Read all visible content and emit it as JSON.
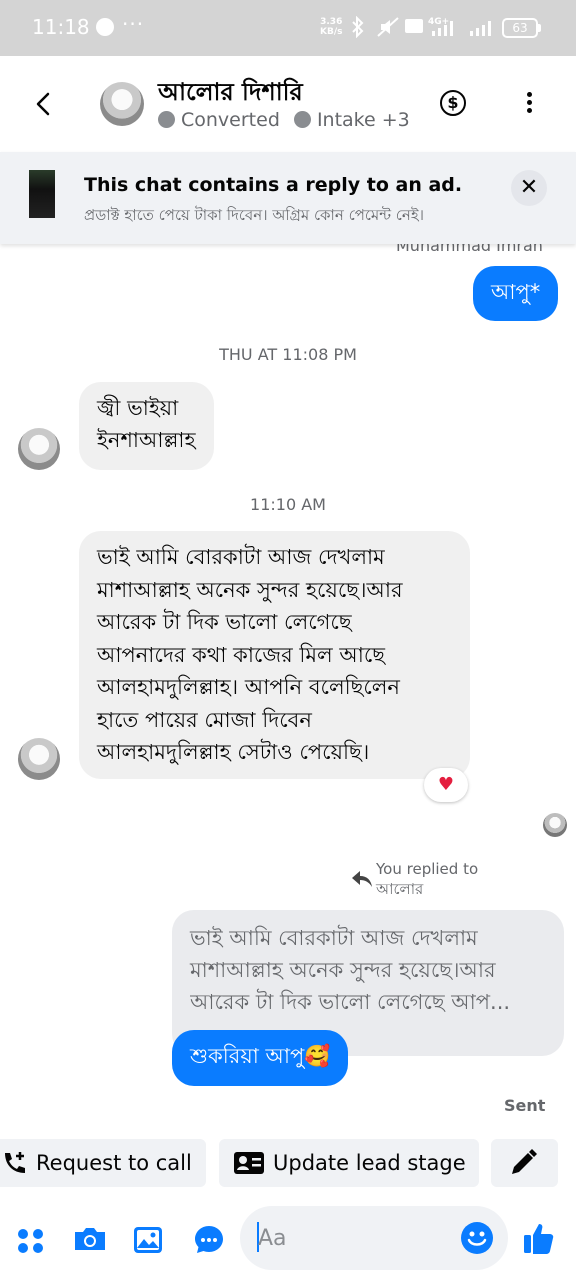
{
  "status_bar": {
    "time": "11:18",
    "dots": "···",
    "speed_value": "3.36",
    "speed_unit": "KB/s",
    "battery": "63"
  },
  "header": {
    "name": "আলোর দিশারি",
    "tag1": "Converted",
    "tag2": "Intake +3"
  },
  "ad_banner": {
    "title": "This chat contains a reply to an ad.",
    "subtitle": "প্রডাক্ট হাতে পেয়ে টাকা দিবেন। অগ্রিম কোন পেমেন্ট নেই।"
  },
  "messages": {
    "cut_name": "Muhammad Imran",
    "m1": "আপু*",
    "time1": "THU AT 11:08 PM",
    "m2_line1": "জ্বী ভাইয়া",
    "m2_line2": "ইনশাআল্লাহ",
    "time2": "11:10 AM",
    "m3_lines": [
      "ভাই আমি বোরকাটা আজ দেখলাম",
      "মাশাআল্লাহ অনেক সুন্দর হয়েছে।আর",
      "আরেক টা দিক ভালো লেগেছে",
      "আপনাদের কথা কাজের মিল আছে",
      "আলহামদুলিল্লাহ। আপনি বলেছিলেন",
      "হাতে পায়ের মোজা দিবেন",
      "আলহামদুলিল্লাহ সেটাও পেয়েছি।"
    ],
    "reaction": "♥",
    "replied_line1": "You replied to",
    "replied_line2": "আলোর",
    "quoted_lines": [
      "ভাই আমি বোরকাটা আজ দেখলাম",
      "মাশাআল্লাহ অনেক সুন্দর হয়েছে।আর",
      "আরেক টা দিক ভালো লেগেছে আপ..."
    ],
    "m4": "শুকরিয়া আপু🥰",
    "status": "Sent"
  },
  "actions": {
    "request_call": "Request to call",
    "update_lead": "Update lead stage"
  },
  "composer": {
    "placeholder": "Aa"
  },
  "colors": {
    "accent": "#0a7cff",
    "bubble_in": "#f0f0f0",
    "muted": "#65676b"
  },
  "icons": [
    "back-arrow-icon",
    "dollar-icon",
    "more-icon",
    "close-icon",
    "heart-icon",
    "reply-arrow-icon",
    "phone-plus-icon",
    "contact-card-icon",
    "pencil-icon",
    "apps-grid-icon",
    "camera-icon",
    "gallery-icon",
    "chat-bubble-icon",
    "emoji-icon",
    "like-icon"
  ]
}
